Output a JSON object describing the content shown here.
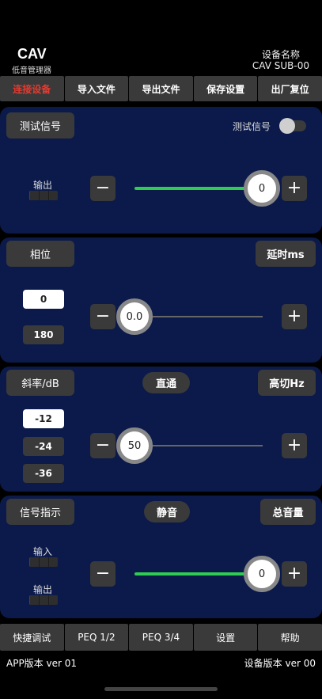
{
  "header": {
    "brand": "CAV",
    "brand_sub": "低音管理器",
    "device_label": "设备名称",
    "device_name": "CAV SUB-00"
  },
  "top_menu": [
    {
      "label": "连接设备",
      "active": true
    },
    {
      "label": "导入文件"
    },
    {
      "label": "导出文件"
    },
    {
      "label": "保存设置"
    },
    {
      "label": "出厂复位"
    }
  ],
  "test_panel": {
    "title": "测试信号",
    "toggle_label": "测试信号",
    "toggle_on": false,
    "output_label": "输出",
    "minus": "−",
    "plus": "+",
    "slider_value": "0",
    "slider_fraction": 1.0
  },
  "phase_panel": {
    "title": "相位",
    "delay_label": "延时ms",
    "phase_options": [
      "0",
      "180"
    ],
    "selected": "0",
    "minus": "−",
    "plus": "+",
    "slider_value": "0.0",
    "slider_fraction": 0.0
  },
  "slope_panel": {
    "title": "斜率/dB",
    "mode_label": "直通",
    "cutoff_label": "高切Hz",
    "slope_options": [
      "-12",
      "-24",
      "-36"
    ],
    "selected": "-12",
    "minus": "−",
    "plus": "+",
    "slider_value": "50",
    "slider_fraction": 0.0
  },
  "signal_panel": {
    "title": "信号指示",
    "mute_label": "静音",
    "volume_label": "总音量",
    "input_label": "输入",
    "output_label": "输出",
    "minus": "−",
    "plus": "+",
    "slider_value": "0",
    "slider_fraction": 1.0
  },
  "bottom_menu": [
    "快捷调试",
    "PEQ 1/2",
    "PEQ 3/4",
    "设置",
    "帮助"
  ],
  "footer": {
    "app_version": "APP版本 ver 01",
    "device_version": "设备版本 ver 00"
  },
  "colors": {
    "panel_bg": "#0b1a4a",
    "active_text": "#e53a2f",
    "slider_fill": "#2ecc50",
    "button_bg": "#3a3a3a"
  }
}
